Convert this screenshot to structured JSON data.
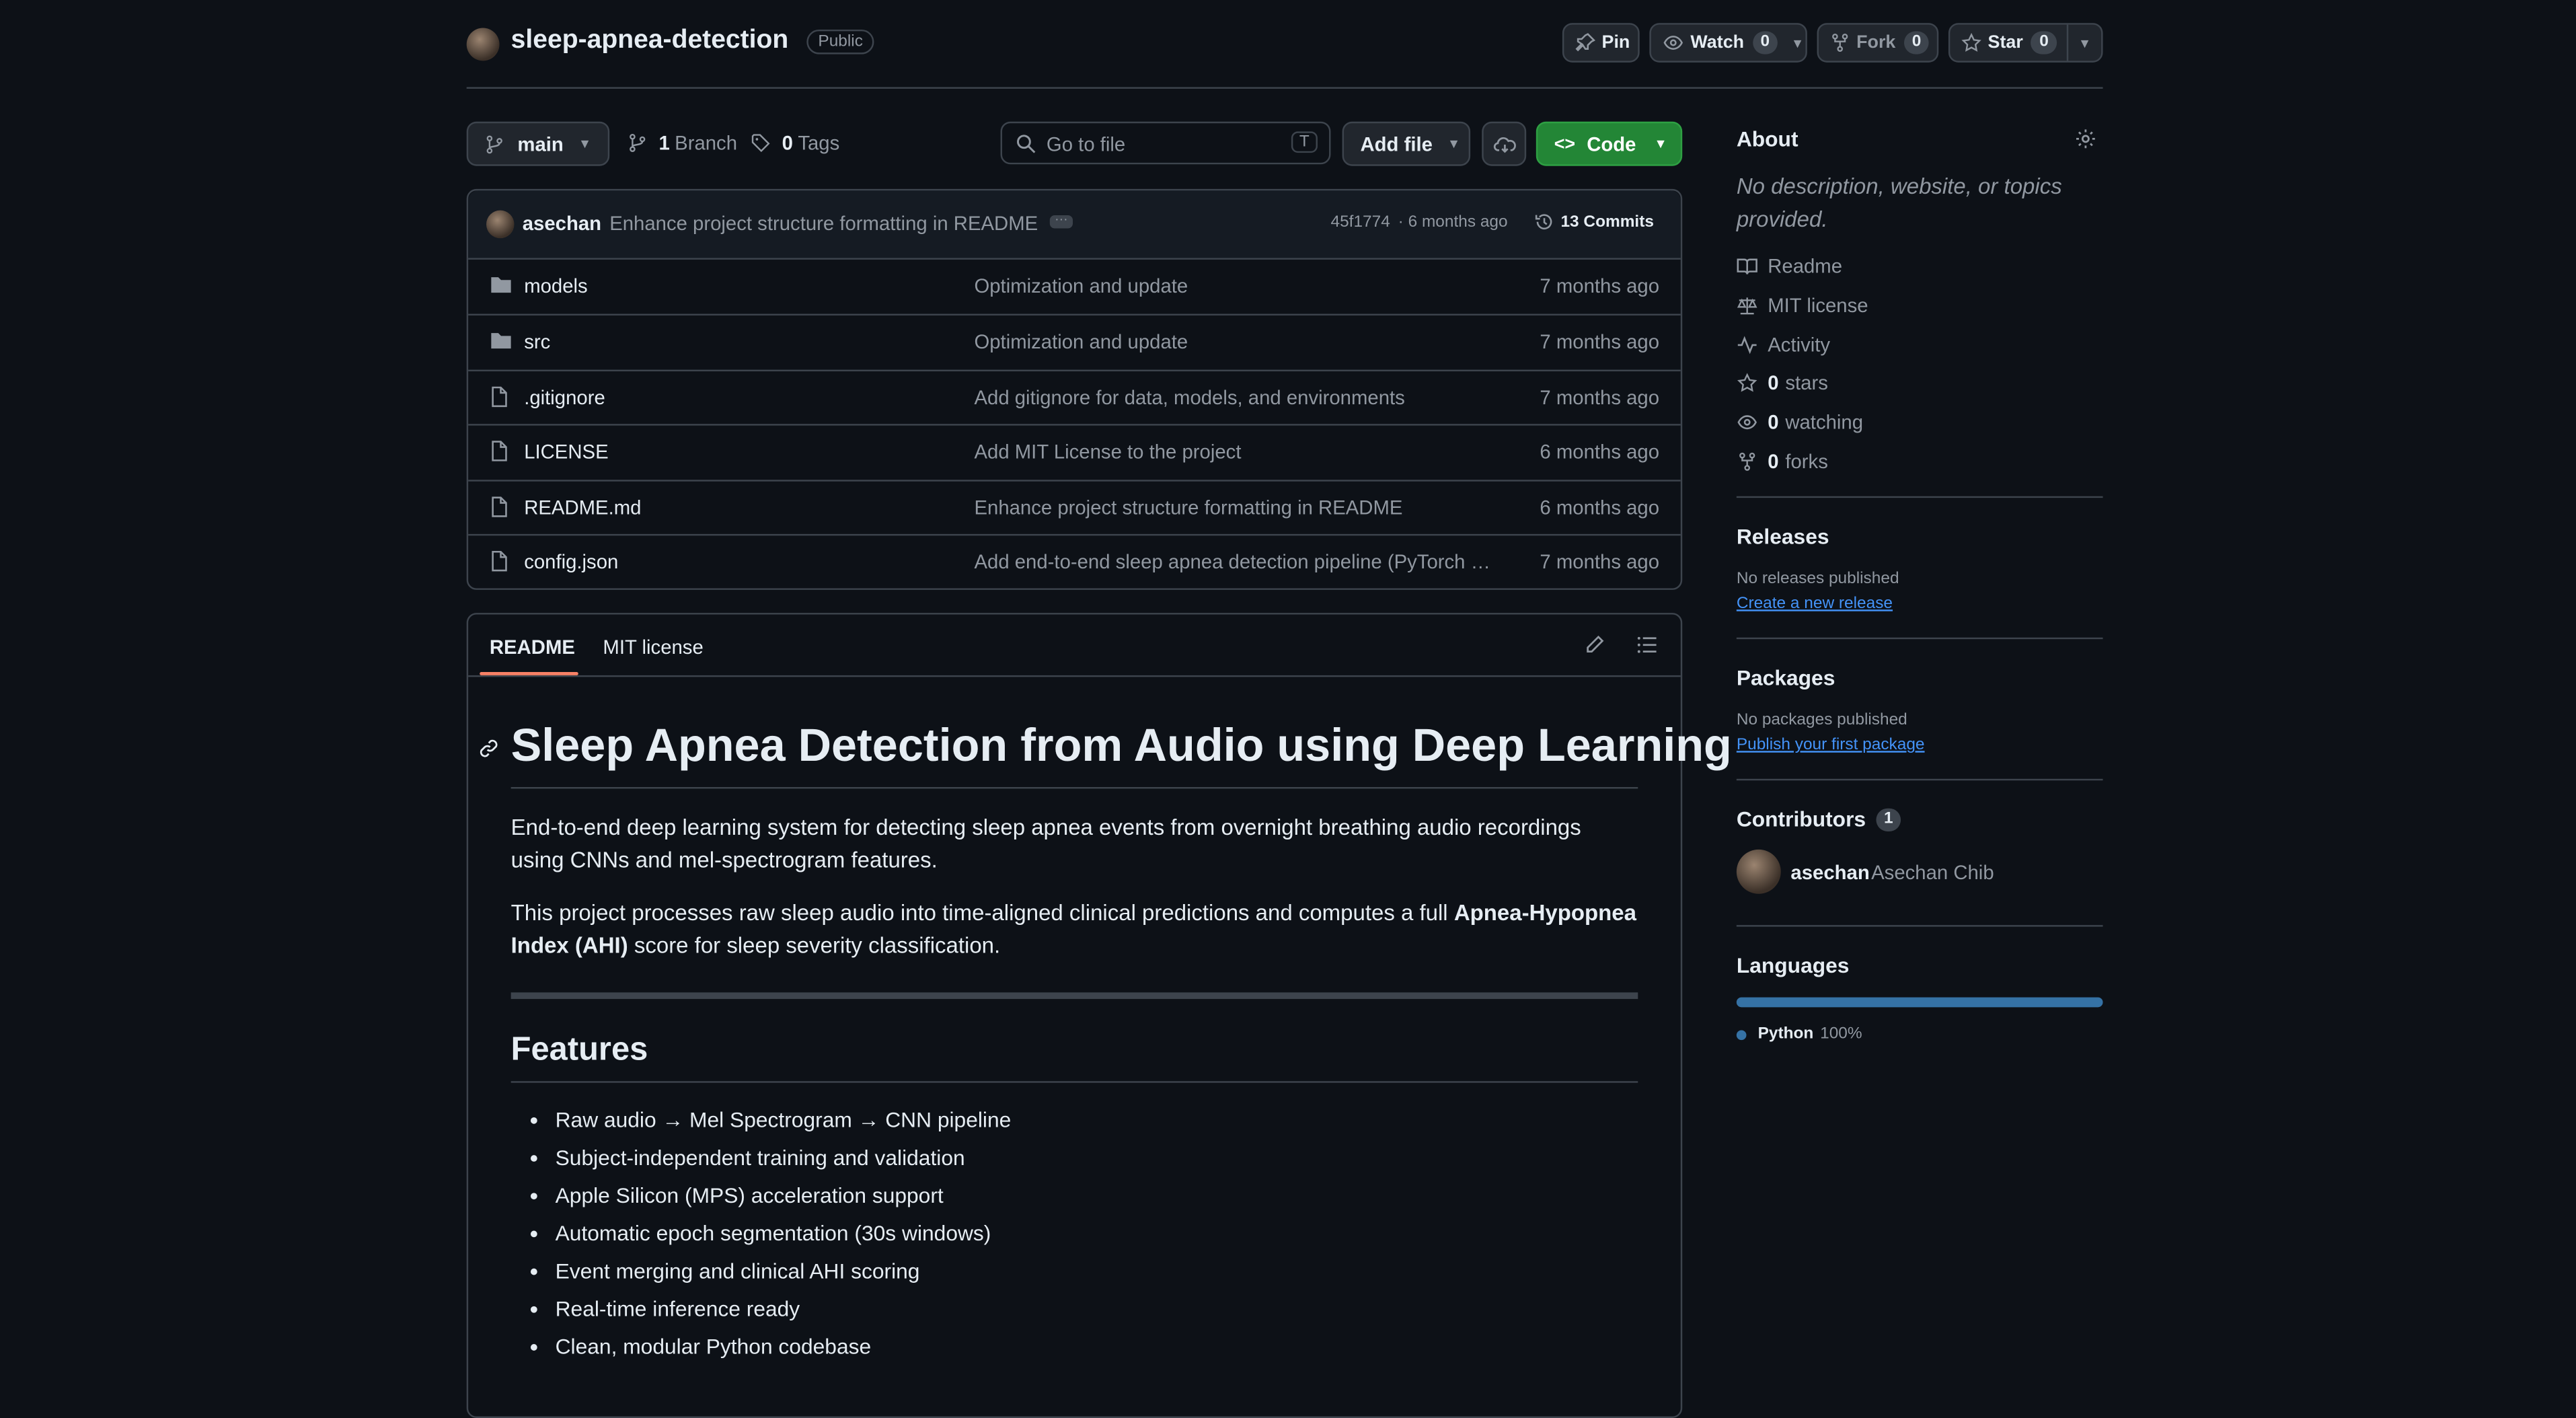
{
  "header": {
    "repo_name": "sleep-apnea-detection",
    "visibility": "Public",
    "pin_label": "Pin",
    "watch_label": "Watch",
    "watch_count": "0",
    "fork_label": "Fork",
    "fork_count": "0",
    "star_label": "Star",
    "star_count": "0"
  },
  "toolbar": {
    "branch": "main",
    "branch_count": "1",
    "branch_label": "Branch",
    "tag_count": "0",
    "tag_label": "Tags",
    "search_placeholder": "Go to file",
    "search_shortcut": "T",
    "add_file_label": "Add file",
    "code_label": "Code"
  },
  "commit": {
    "author": "asechan",
    "message": "Enhance project structure formatting in README",
    "hash": "45f1774",
    "time": "· 6 months ago",
    "commits_label": "13 Commits"
  },
  "files": [
    {
      "name": "models",
      "type": "folder",
      "message": "Optimization and update",
      "time": "7 months ago"
    },
    {
      "name": "src",
      "type": "folder",
      "message": "Optimization and update",
      "time": "7 months ago"
    },
    {
      "name": ".gitignore",
      "type": "file",
      "message": "Add gitignore for data, models, and environments",
      "time": "7 months ago"
    },
    {
      "name": "LICENSE",
      "type": "file",
      "message": "Add MIT License to the project",
      "time": "6 months ago"
    },
    {
      "name": "README.md",
      "type": "file",
      "message": "Enhance project structure formatting in README",
      "time": "6 months ago"
    },
    {
      "name": "config.json",
      "type": "file",
      "message": "Add end-to-end sleep apnea detection pipeline (PyTorch …",
      "time": "7 months ago"
    }
  ],
  "readme": {
    "tabs": [
      "README",
      "MIT license"
    ],
    "title": "Sleep Apnea Detection from Audio using Deep Learning",
    "para1": "End-to-end deep learning system for detecting sleep apnea events from overnight breathing audio recordings using CNNs and mel-spectrogram features.",
    "para2_pre": "This project processes raw sleep audio into time-aligned clinical predictions and computes a full ",
    "para2_bold": "Apnea-Hypopnea Index (AHI)",
    "para2_post": " score for sleep severity classification.",
    "features_heading": "Features",
    "features": [
      "Raw audio → Mel Spectrogram → CNN pipeline",
      "Subject-independent training and validation",
      "Apple Silicon (MPS) acceleration support",
      "Automatic epoch segmentation (30s windows)",
      "Event merging and clinical AHI scoring",
      "Real-time inference ready",
      "Clean, modular Python codebase"
    ]
  },
  "sidebar": {
    "about_heading": "About",
    "about_text": "No description, website, or topics provided.",
    "links": {
      "readme": "Readme",
      "license": "MIT license",
      "activity": "Activity",
      "stars_count": "0",
      "stars_label": "stars",
      "watching_count": "0",
      "watching_label": "watching",
      "forks_count": "0",
      "forks_label": "forks"
    },
    "releases_heading": "Releases",
    "releases_text": "No releases published",
    "releases_link": "Create a new release",
    "packages_heading": "Packages",
    "packages_text": "No packages published",
    "packages_link": "Publish your first package",
    "contributors_heading": "Contributors",
    "contributors_count": "1",
    "contributor_login": "asechan",
    "contributor_name": "Asechan Chib",
    "languages_heading": "Languages",
    "language_name": "Python",
    "language_percent": "100%",
    "language_color": "#3572A5"
  },
  "colors": {
    "background": "#0d1117",
    "accent_green": "#238636",
    "link_blue": "#4493f8",
    "tab_underline": "#f78166"
  }
}
